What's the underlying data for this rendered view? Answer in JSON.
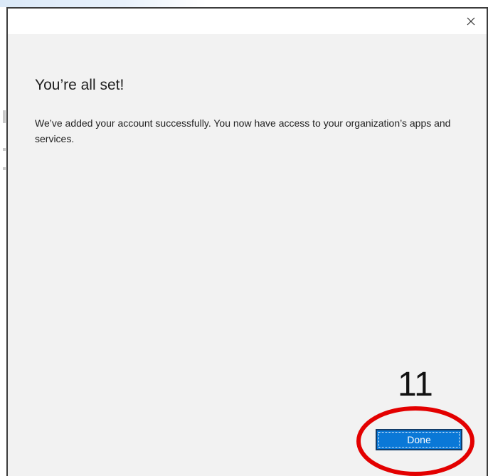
{
  "window": {
    "close_icon": "close-icon"
  },
  "content": {
    "heading": "You’re all set!",
    "message": "We’ve added your account successfully. You now have access to your organization’s apps and services."
  },
  "actions": {
    "done_label": "Done"
  },
  "annotation": {
    "step_number": "11",
    "highlight_color": "#e30000"
  },
  "colors": {
    "accent": "#0a78d7",
    "dialog_background": "#f2f2f2",
    "titlebar_background": "#ffffff"
  }
}
